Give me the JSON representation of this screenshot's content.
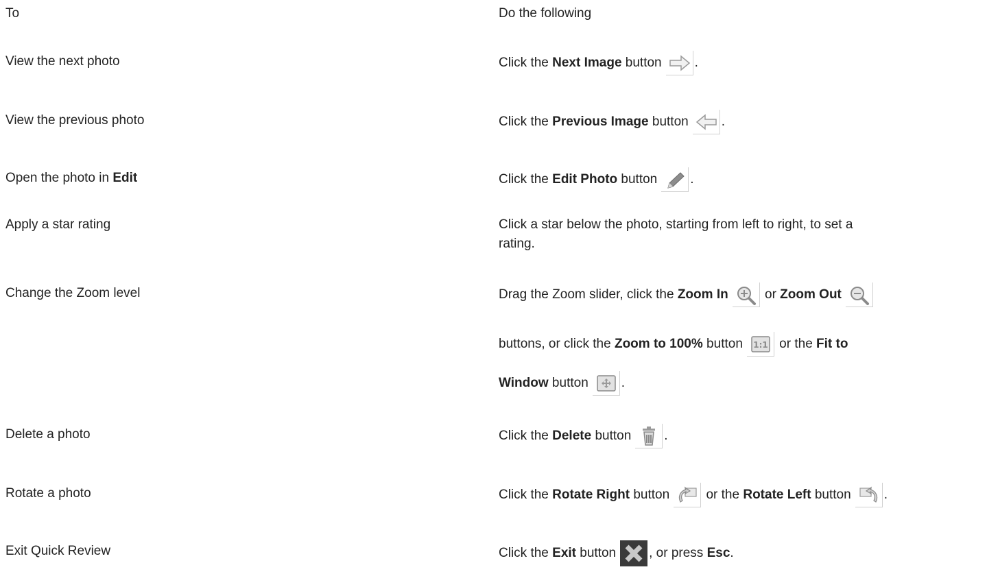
{
  "header": {
    "col1": "To",
    "col2": "Do the following"
  },
  "rows": [
    {
      "to": "View the next photo",
      "p1": "Click the ",
      "k1": "Next Image",
      "p2": " button",
      "end": "."
    },
    {
      "to": "View the previous photo",
      "p1": "Click the ",
      "k1": "Previous Image",
      "p2": " button",
      "end": "."
    },
    {
      "to_p1": "Open the photo in ",
      "to_k1": "Edit",
      "p1": "Click the ",
      "k1": "Edit Photo",
      "p2": " button",
      "end": "."
    },
    {
      "to": "Apply a star rating",
      "l1": "Click a star below the photo, starting from left to right, to set a",
      "l2": "rating."
    },
    {
      "to": "Change the Zoom level",
      "p1": "Drag the Zoom slider, click the ",
      "k1": "Zoom In",
      "p2": " or ",
      "k2": "Zoom Out",
      "p3": "buttons, or click the ",
      "k3": "Zoom to 100%",
      "p4": " button",
      "p5": " or the ",
      "k4": "Fit to",
      "k5": "Window",
      "p6": " button",
      "end": "."
    },
    {
      "to": "Delete a photo",
      "p1": "Click the ",
      "k1": "Delete",
      "p2": " button",
      "end": "."
    },
    {
      "to": "Rotate a photo",
      "p1": "Click the ",
      "k1": "Rotate Right",
      "p2": " button",
      "p3": " or the ",
      "k2": "Rotate Left",
      "p4": " button",
      "end": "."
    },
    {
      "to": "Exit Quick Review",
      "p1": "Click the ",
      "k1": "Exit",
      "p2": " button",
      "p3": ", or press ",
      "k2": "Esc",
      "end": "."
    }
  ]
}
